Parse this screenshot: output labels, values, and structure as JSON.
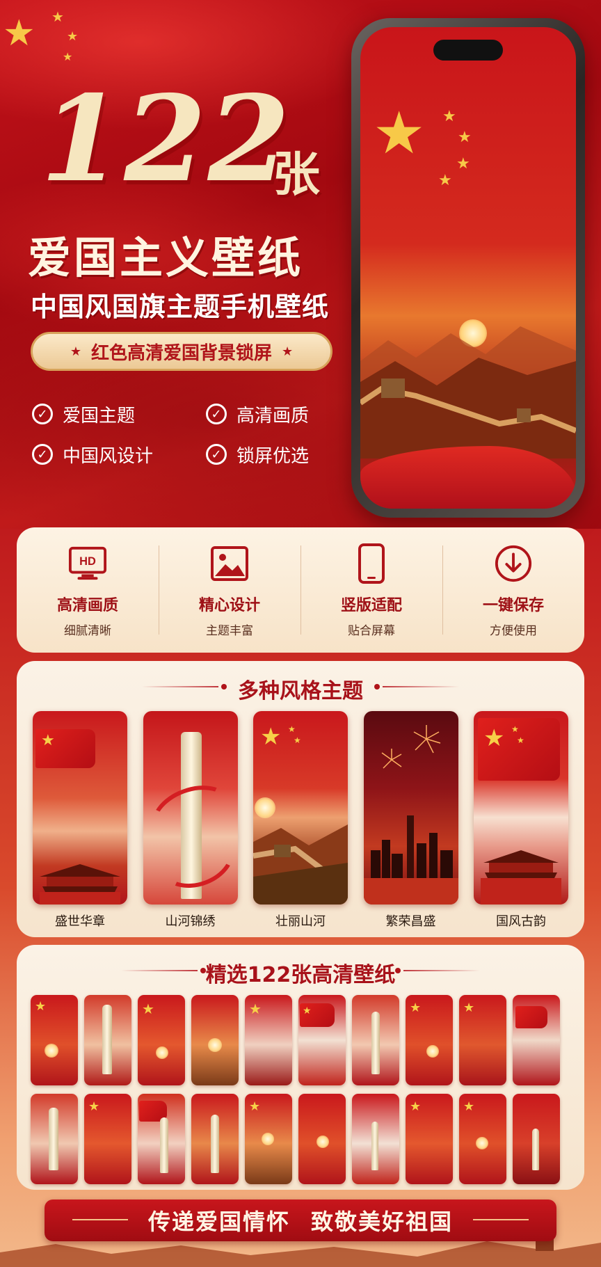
{
  "colors": {
    "primary_red": "#c8161a",
    "gold": "#f7c948",
    "cream": "#fbf2e6",
    "dark_red": "#9e1016"
  },
  "hero": {
    "count": "122",
    "unit": "张",
    "title": "爱国主义壁纸",
    "subtitle": "中国风国旗主题手机壁纸",
    "tag": "红色高清爱国背景锁屏",
    "features": [
      "爱国主题",
      "高清画质",
      "中国风设计",
      "锁屏优选"
    ]
  },
  "highlights": [
    {
      "icon": "hd-monitor-icon",
      "title": "高清画质",
      "sub": "细腻清晰"
    },
    {
      "icon": "image-icon",
      "title": "精心设计",
      "sub": "主题丰富"
    },
    {
      "icon": "smartphone-icon",
      "title": "竖版适配",
      "sub": "贴合屏幕"
    },
    {
      "icon": "download-circle-icon",
      "title": "一键保存",
      "sub": "方便使用"
    }
  ],
  "styles_section": {
    "title": "多种风格主题",
    "items": [
      "盛世华章",
      "山河锦绣",
      "壮丽山河",
      "繁荣昌盛",
      "国风古韵"
    ]
  },
  "gallery_section": {
    "title": "精选122张高清壁纸"
  },
  "banner": {
    "left": "传递爱国情怀",
    "right": "致敬美好祖国"
  }
}
